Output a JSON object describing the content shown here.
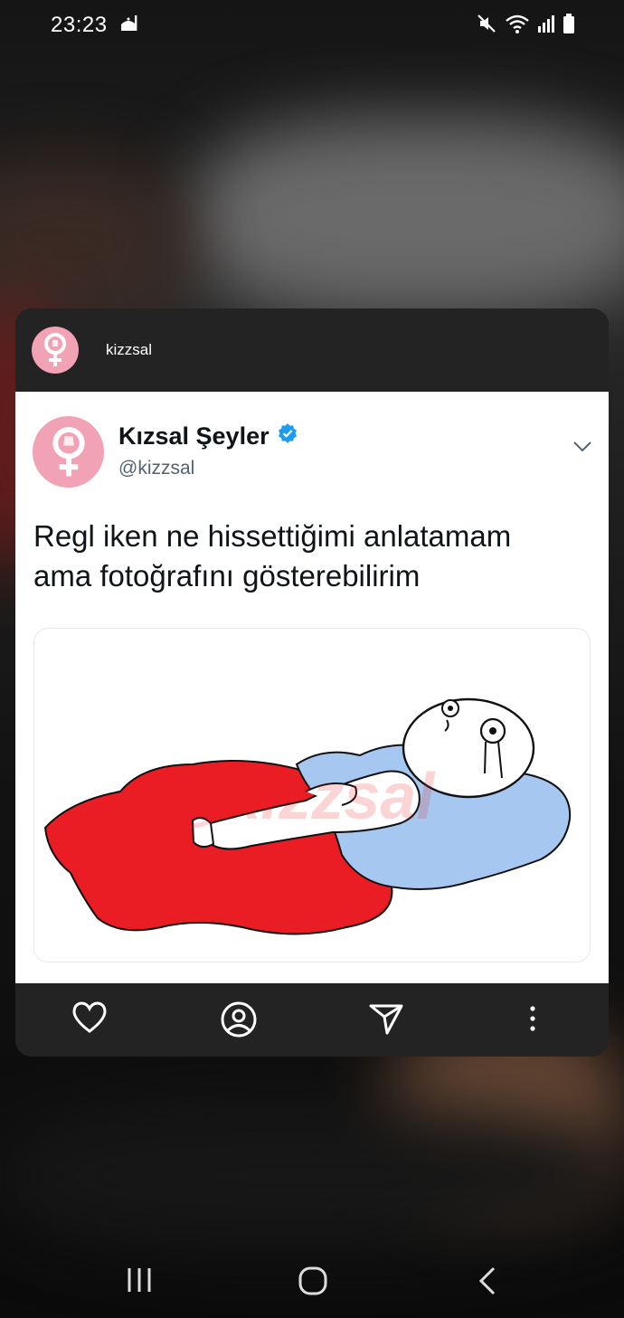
{
  "status_bar": {
    "time": "23:23"
  },
  "card": {
    "header_username": "kizzsal",
    "tweet": {
      "display_name": "Kızsal Şeyler",
      "handle": "@kizzsal",
      "text_line1": "Regl iken ne hissettiğimi anlatamam",
      "text_line2": "ama fotoğrafını gösterebilirim",
      "watermark": "@kizzsal"
    },
    "actions": [
      "heart-icon",
      "profile-icon",
      "send-icon",
      "more-icon"
    ]
  },
  "colors": {
    "avatar_pink": "#f2a2b5",
    "verified_blue": "#1d9bf0",
    "blood_red": "#ea1c24",
    "water_blue": "#a6c8f0",
    "card_dark": "#232323"
  }
}
